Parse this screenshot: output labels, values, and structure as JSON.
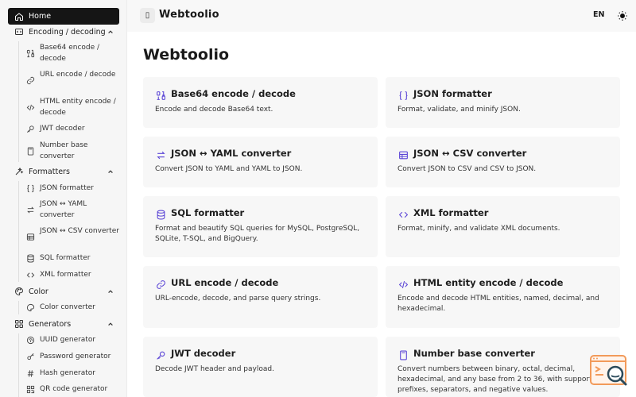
{
  "app": {
    "title": "Webtoolio",
    "language": "EN"
  },
  "sidebar": {
    "home": "Home",
    "groups": [
      {
        "label": "Encoding / decoding",
        "items": [
          "Base64 encode / decode",
          "URL encode / decode",
          "HTML entity encode / decode",
          "JWT decoder",
          "Number base converter"
        ]
      },
      {
        "label": "Formatters",
        "items": [
          "JSON formatter",
          "JSON ↔ YAML converter",
          "JSON ↔ CSV converter",
          "SQL formatter",
          "XML formatter"
        ]
      },
      {
        "label": "Color",
        "items": [
          "Color converter"
        ]
      },
      {
        "label": "Generators",
        "items": [
          "UUID generator",
          "Password generator",
          "Hash generator",
          "QR code generator"
        ]
      }
    ]
  },
  "main": {
    "title": "Webtoolio",
    "cards": [
      {
        "title": "Base64 encode / decode",
        "desc": "Encode and decode Base64 text."
      },
      {
        "title": "JSON formatter",
        "desc": "Format, validate, and minify JSON."
      },
      {
        "title": "JSON ↔ YAML converter",
        "desc": "Convert JSON to YAML and YAML to JSON."
      },
      {
        "title": "JSON ↔ CSV converter",
        "desc": "Convert JSON to CSV and CSV to JSON."
      },
      {
        "title": "SQL formatter",
        "desc": "Format and beautify SQL queries for MySQL, PostgreSQL, SQLite, T-SQL, and BigQuery."
      },
      {
        "title": "XML formatter",
        "desc": "Format, minify, and validate XML documents."
      },
      {
        "title": "URL encode / decode",
        "desc": "URL-encode, decode, and parse query strings."
      },
      {
        "title": "HTML entity encode / decode",
        "desc": "Encode and decode HTML entities, named, decimal, and hexadecimal."
      },
      {
        "title": "JWT decoder",
        "desc": "Decode JWT header and payload."
      },
      {
        "title": "Number base converter",
        "desc": "Convert numbers between binary, octal, decimal, hexadecimal, and any base from 2 to 36, with support for prefixes, separators, and negative values."
      }
    ]
  },
  "colors": {
    "accent": "#5b45d6",
    "sidebar_active": "#151515",
    "card_bg": "#f7f7f7",
    "widget": "#f29a5a"
  }
}
